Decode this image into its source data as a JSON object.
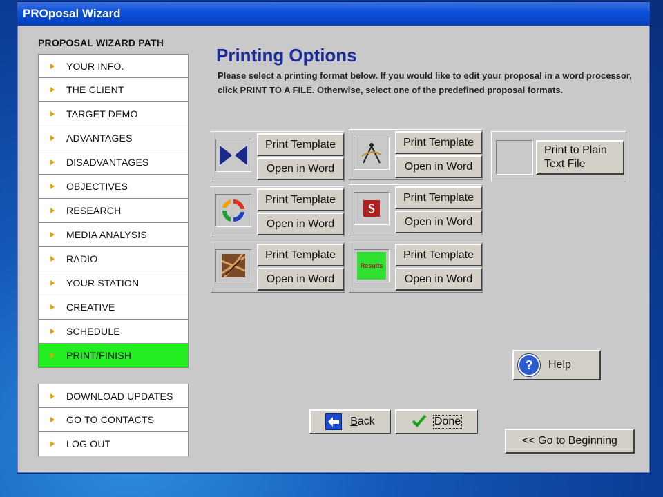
{
  "window": {
    "title": "PROposal Wizard"
  },
  "sidebar": {
    "title": "PROPOSAL WIZARD PATH",
    "items": [
      {
        "label": "YOUR INFO."
      },
      {
        "label": "THE CLIENT"
      },
      {
        "label": "TARGET DEMO"
      },
      {
        "label": "ADVANTAGES"
      },
      {
        "label": "DISADVANTAGES"
      },
      {
        "label": "OBJECTIVES"
      },
      {
        "label": "RESEARCH"
      },
      {
        "label": "MEDIA ANALYSIS"
      },
      {
        "label": "RADIO"
      },
      {
        "label": "YOUR STATION"
      },
      {
        "label": "CREATIVE"
      },
      {
        "label": "SCHEDULE"
      },
      {
        "label": "PRINT/FINISH",
        "active": true
      }
    ],
    "extra_items": [
      {
        "label": "DOWNLOAD UPDATES"
      },
      {
        "label": "GO TO CONTACTS"
      },
      {
        "label": "LOG OUT"
      }
    ],
    "active_color": "#22ee22"
  },
  "main": {
    "title": "Printing Options",
    "description": "Please select a printing format below.  If you would like to edit your proposal in a word processor, click PRINT TO A FILE.  Otherwise, select one of the predefined proposal formats.",
    "templates": [
      {
        "icon": "arrows-converge-icon",
        "print_label": "Print Template",
        "open_label": "Open in Word"
      },
      {
        "icon": "compass-icon",
        "print_label": "Print Template",
        "open_label": "Open in Word"
      },
      {
        "icon": "recycle-arrows-icon",
        "print_label": "Print Template",
        "open_label": "Open in Word"
      },
      {
        "icon": "s-logo-icon",
        "print_label": "Print Template",
        "open_label": "Open in Word"
      },
      {
        "icon": "abstract-image-icon",
        "print_label": "Print Template",
        "open_label": "Open in Word"
      },
      {
        "icon": "results-thumbnail-icon",
        "print_label": "Print Template",
        "open_label": "Open in Word",
        "thumb_text": "Results"
      }
    ],
    "plain_text_label_line1": "Print to Plain",
    "plain_text_label_line2": "Text File",
    "help_label": "Help",
    "back_label_first": "B",
    "back_label_rest": "ack",
    "done_label": "Done",
    "go_beginning_label": "<< Go to Beginning"
  }
}
